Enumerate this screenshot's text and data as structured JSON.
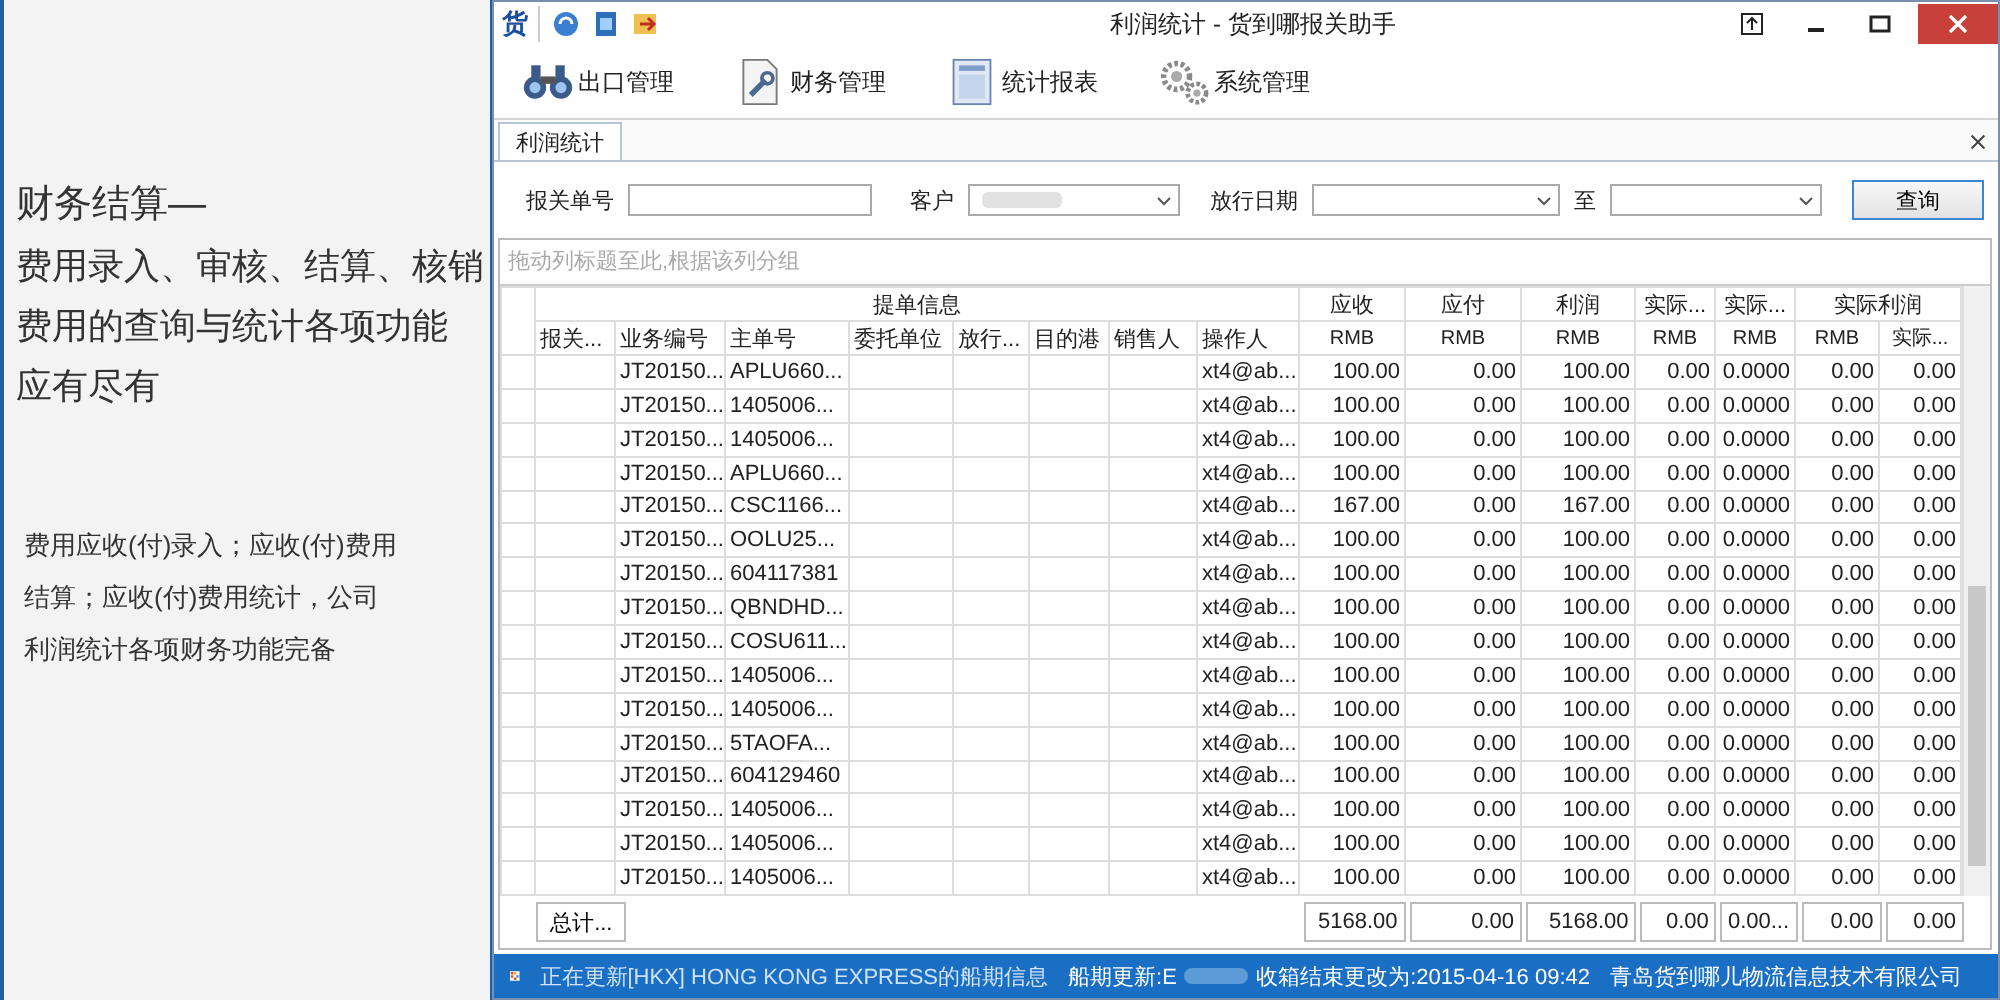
{
  "promo": {
    "heading": "财务结算—",
    "description_lines": [
      "费用录入、审核、结算、核销",
      "费用的查询与统计各项功能",
      "应有尽有"
    ],
    "detail_lines": [
      "费用应收(付)录入；应收(付)费用",
      "结算；应收(付)费用统计，公司",
      "利润统计各项财务功能完备"
    ]
  },
  "window": {
    "logo": "货",
    "title": "利润统计 - 货到哪报关助手"
  },
  "toolbar": [
    {
      "label": "出口管理",
      "kind": "binoculars"
    },
    {
      "label": "财务管理",
      "kind": "finance"
    },
    {
      "label": "统计报表",
      "kind": "report"
    },
    {
      "label": "系统管理",
      "kind": "gears"
    }
  ],
  "tabs": [
    {
      "label": "利润统计",
      "selected": true
    }
  ],
  "filters": {
    "customs_no_label": "报关单号",
    "customer_label": "客户",
    "release_date_label": "放行日期",
    "to_label": "至",
    "query_button": "查询"
  },
  "group_hint": "拖动列标题至此,根据该列分组",
  "table": {
    "column_groups": [
      {
        "label": "提单信息",
        "columns": [
          {
            "label": "报关..."
          },
          {
            "label": "业务编号"
          },
          {
            "label": "主单号"
          },
          {
            "label": "委托单位"
          },
          {
            "label": "放行..."
          },
          {
            "label": "目的港"
          },
          {
            "label": "销售人"
          },
          {
            "label": "操作人"
          }
        ]
      },
      {
        "label": "应收",
        "columns": [
          {
            "label": "RMB"
          }
        ]
      },
      {
        "label": "应付",
        "columns": [
          {
            "label": "RMB"
          }
        ]
      },
      {
        "label": "利润",
        "columns": [
          {
            "label": "RMB"
          }
        ]
      },
      {
        "label": "实际...",
        "columns": [
          {
            "label": "RMB"
          }
        ]
      },
      {
        "label": "实际...",
        "columns": [
          {
            "label": "RMB"
          }
        ]
      },
      {
        "label": "实际利润",
        "columns": [
          {
            "label": "RMB"
          },
          {
            "label": "实际..."
          }
        ]
      }
    ],
    "rows": [
      {
        "business_no": "JT20150...",
        "master_no": "APLU660...",
        "operator": "xt4@ab...",
        "receivable": "100.00",
        "payable": "0.00",
        "profit": "100.00",
        "actual_a": "0.00",
        "actual_b": "0.0000",
        "actual_profit_rmb": "0.00",
        "actual_profit_other": "0.00"
      },
      {
        "business_no": "JT20150...",
        "master_no": "1405006...",
        "operator": "xt4@ab...",
        "receivable": "100.00",
        "payable": "0.00",
        "profit": "100.00",
        "actual_a": "0.00",
        "actual_b": "0.0000",
        "actual_profit_rmb": "0.00",
        "actual_profit_other": "0.00"
      },
      {
        "business_no": "JT20150...",
        "master_no": "1405006...",
        "operator": "xt4@ab...",
        "receivable": "100.00",
        "payable": "0.00",
        "profit": "100.00",
        "actual_a": "0.00",
        "actual_b": "0.0000",
        "actual_profit_rmb": "0.00",
        "actual_profit_other": "0.00"
      },
      {
        "business_no": "JT20150...",
        "master_no": "APLU660...",
        "operator": "xt4@ab...",
        "receivable": "100.00",
        "payable": "0.00",
        "profit": "100.00",
        "actual_a": "0.00",
        "actual_b": "0.0000",
        "actual_profit_rmb": "0.00",
        "actual_profit_other": "0.00"
      },
      {
        "business_no": "JT20150...",
        "master_no": "CSC1166...",
        "operator": "xt4@ab...",
        "receivable": "167.00",
        "payable": "0.00",
        "profit": "167.00",
        "actual_a": "0.00",
        "actual_b": "0.0000",
        "actual_profit_rmb": "0.00",
        "actual_profit_other": "0.00"
      },
      {
        "business_no": "JT20150...",
        "master_no": "OOLU25...",
        "operator": "xt4@ab...",
        "receivable": "100.00",
        "payable": "0.00",
        "profit": "100.00",
        "actual_a": "0.00",
        "actual_b": "0.0000",
        "actual_profit_rmb": "0.00",
        "actual_profit_other": "0.00"
      },
      {
        "business_no": "JT20150...",
        "master_no": "604117381",
        "operator": "xt4@ab...",
        "receivable": "100.00",
        "payable": "0.00",
        "profit": "100.00",
        "actual_a": "0.00",
        "actual_b": "0.0000",
        "actual_profit_rmb": "0.00",
        "actual_profit_other": "0.00"
      },
      {
        "business_no": "JT20150...",
        "master_no": "QBNDHD...",
        "operator": "xt4@ab...",
        "receivable": "100.00",
        "payable": "0.00",
        "profit": "100.00",
        "actual_a": "0.00",
        "actual_b": "0.0000",
        "actual_profit_rmb": "0.00",
        "actual_profit_other": "0.00"
      },
      {
        "business_no": "JT20150...",
        "master_no": "COSU611...",
        "operator": "xt4@ab...",
        "receivable": "100.00",
        "payable": "0.00",
        "profit": "100.00",
        "actual_a": "0.00",
        "actual_b": "0.0000",
        "actual_profit_rmb": "0.00",
        "actual_profit_other": "0.00"
      },
      {
        "business_no": "JT20150...",
        "master_no": "1405006...",
        "operator": "xt4@ab...",
        "receivable": "100.00",
        "payable": "0.00",
        "profit": "100.00",
        "actual_a": "0.00",
        "actual_b": "0.0000",
        "actual_profit_rmb": "0.00",
        "actual_profit_other": "0.00"
      },
      {
        "business_no": "JT20150...",
        "master_no": "1405006...",
        "operator": "xt4@ab...",
        "receivable": "100.00",
        "payable": "0.00",
        "profit": "100.00",
        "actual_a": "0.00",
        "actual_b": "0.0000",
        "actual_profit_rmb": "0.00",
        "actual_profit_other": "0.00"
      },
      {
        "business_no": "JT20150...",
        "master_no": "5TAOFA...",
        "operator": "xt4@ab...",
        "receivable": "100.00",
        "payable": "0.00",
        "profit": "100.00",
        "actual_a": "0.00",
        "actual_b": "0.0000",
        "actual_profit_rmb": "0.00",
        "actual_profit_other": "0.00"
      },
      {
        "business_no": "JT20150...",
        "master_no": "604129460",
        "operator": "xt4@ab...",
        "receivable": "100.00",
        "payable": "0.00",
        "profit": "100.00",
        "actual_a": "0.00",
        "actual_b": "0.0000",
        "actual_profit_rmb": "0.00",
        "actual_profit_other": "0.00"
      },
      {
        "business_no": "JT20150...",
        "master_no": "1405006...",
        "operator": "xt4@ab...",
        "receivable": "100.00",
        "payable": "0.00",
        "profit": "100.00",
        "actual_a": "0.00",
        "actual_b": "0.0000",
        "actual_profit_rmb": "0.00",
        "actual_profit_other": "0.00"
      },
      {
        "business_no": "JT20150...",
        "master_no": "1405006...",
        "operator": "xt4@ab...",
        "receivable": "100.00",
        "payable": "0.00",
        "profit": "100.00",
        "actual_a": "0.00",
        "actual_b": "0.0000",
        "actual_profit_rmb": "0.00",
        "actual_profit_other": "0.00"
      },
      {
        "business_no": "JT20150...",
        "master_no": "1405006...",
        "operator": "xt4@ab...",
        "receivable": "100.00",
        "payable": "0.00",
        "profit": "100.00",
        "actual_a": "0.00",
        "actual_b": "0.0000",
        "actual_profit_rmb": "0.00",
        "actual_profit_other": "0.00"
      }
    ],
    "totals_button": "总计...",
    "totals": {
      "receivable": "5168.00",
      "payable": "0.00",
      "profit": "5168.00",
      "actual_a": "0.00",
      "actual_b": "0.00...",
      "actual_profit_rmb": "0.00",
      "actual_profit_other": "0.00"
    }
  },
  "status_bar": {
    "message": "正在更新[HKX] HONG KONG EXPRESS的船期信息",
    "schedule_prefix": "船期更新:E",
    "schedule_suffix": "收箱结束更改为:2015-04-16 09:42",
    "company": "青岛货到哪儿物流信息技术有限公司"
  }
}
